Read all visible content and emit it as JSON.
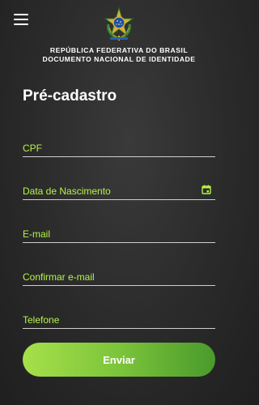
{
  "header": {
    "menu_icon": "hamburger-menu-icon",
    "emblem": "brazil-coat-of-arms",
    "line1": "REPÚBLICA FEDERATIVA DO BRASIL",
    "line2": "DOCUMENTO NACIONAL DE IDENTIDADE"
  },
  "form": {
    "title": "Pré-cadastro",
    "fields": [
      {
        "label": "CPF",
        "value": ""
      },
      {
        "label": "Data de Nascimento",
        "value": "",
        "icon": "calendar-icon"
      },
      {
        "label": "E-mail",
        "value": ""
      },
      {
        "label": "Confirmar e-mail",
        "value": ""
      },
      {
        "label": "Telefone",
        "value": ""
      }
    ],
    "submit_label": "Enviar"
  },
  "colors": {
    "background": "#2a2a2a",
    "label_accent": "#b6f24a",
    "button_start": "#a6e04a",
    "button_end": "#4a9a2c",
    "underline": "#cfcfcf"
  }
}
